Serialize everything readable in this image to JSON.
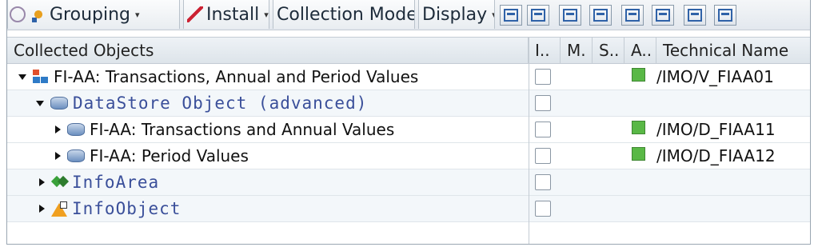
{
  "toolbar": {
    "grouping_label": "Grouping",
    "install_label": "Install",
    "collection_mode_label": "Collection Mode",
    "display_label": "Display"
  },
  "header": {
    "col_collected": "Collected Objects",
    "col_i": "I..",
    "col_m": "M.",
    "col_s": "S..",
    "col_a": "A..",
    "col_tech": "Technical Name"
  },
  "rows": [
    {
      "label": "FI-AA: Transactions, Annual and Period Values",
      "tech": "/IMO/V_FIAA01",
      "icon": "tree-structure-icon"
    },
    {
      "label": "DataStore Object (advanced)",
      "tech": "",
      "icon": "datastore-icon"
    },
    {
      "label": "FI-AA: Transactions and Annual Values",
      "tech": "/IMO/D_FIAA11",
      "icon": "datastore-icon"
    },
    {
      "label": "FI-AA: Period Values",
      "tech": "/IMO/D_FIAA12",
      "icon": "datastore-icon"
    },
    {
      "label": "InfoArea",
      "tech": "",
      "icon": "infoarea-icon"
    },
    {
      "label": "InfoObject",
      "tech": "",
      "icon": "infoobject-icon"
    }
  ],
  "colors": {
    "active_status": "#59b846"
  }
}
